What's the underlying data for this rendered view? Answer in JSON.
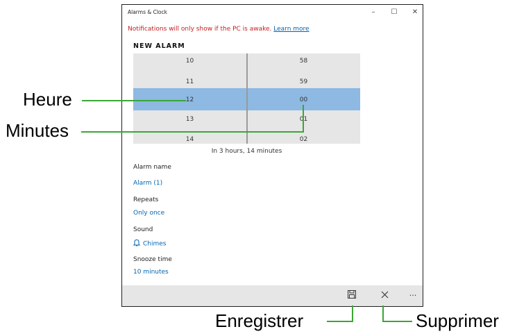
{
  "window": {
    "title": "Alarms & Clock",
    "controls": {
      "minimize": "–",
      "maximize": "☐",
      "close": "✕"
    }
  },
  "notification": {
    "text": "Notifications will only show if the PC is awake. ",
    "link": "Learn more"
  },
  "heading": "NEW ALARM",
  "picker": {
    "hours": [
      "10",
      "11",
      "12",
      "13",
      "14"
    ],
    "minutes": [
      "58",
      "59",
      "00",
      "01",
      "02"
    ],
    "selected_hour": "12",
    "selected_minute": "00",
    "selection_color": "#8db9e2"
  },
  "time_until": "In 3 hours, 14 minutes",
  "fields": {
    "alarm_name": {
      "label": "Alarm name",
      "value": "Alarm (1)"
    },
    "repeats": {
      "label": "Repeats",
      "value": "Only once"
    },
    "sound": {
      "label": "Sound",
      "value": "Chimes",
      "icon": "bell-icon"
    },
    "snooze": {
      "label": "Snooze time",
      "value": "10 minutes"
    }
  },
  "command_bar": {
    "save_icon": "save-icon",
    "delete_icon": "close-icon",
    "more": "···"
  },
  "callouts": {
    "hour": "Heure",
    "minutes": "Minutes",
    "save": "Enregistrer",
    "delete": "Supprimer"
  },
  "colors": {
    "accent": "#0063b1",
    "warning": "#c41e1e",
    "leader": "#3aa635"
  }
}
